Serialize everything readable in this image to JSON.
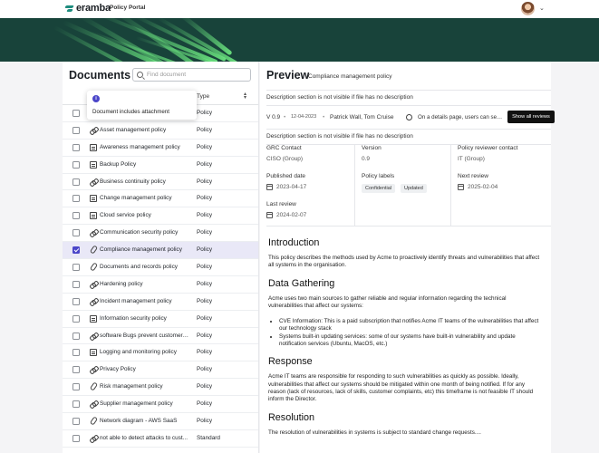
{
  "header": {
    "brand": "eramba",
    "portal": "Policy Portal"
  },
  "documents": {
    "title": "Documents",
    "search_placeholder": "Find document",
    "type_header": "Type",
    "tooltip": "Document includes attachment",
    "rows": [
      {
        "name": "",
        "type": "Policy",
        "icon": "none"
      },
      {
        "name": "Asset management policy",
        "type": "Policy",
        "icon": "link-icon"
      },
      {
        "name": "Awareness management policy",
        "type": "Policy",
        "icon": "document-icon"
      },
      {
        "name": "Backup Policy",
        "type": "Policy",
        "icon": "document-icon"
      },
      {
        "name": "Business continuity policy",
        "type": "Policy",
        "icon": "link-icon"
      },
      {
        "name": "Change management policy",
        "type": "Policy",
        "icon": "document-icon"
      },
      {
        "name": "Cloud service policy",
        "type": "Policy",
        "icon": "document-icon"
      },
      {
        "name": "Communication security policy",
        "type": "Policy",
        "icon": "link-icon"
      },
      {
        "name": "Compliance management policy",
        "type": "Policy",
        "icon": "paperclip-icon",
        "selected": true
      },
      {
        "name": "Documents and records policy",
        "type": "Policy",
        "icon": "paperclip-icon"
      },
      {
        "name": "Hardening policy",
        "type": "Policy",
        "icon": "link-icon"
      },
      {
        "name": "Incident management policy",
        "type": "Policy",
        "icon": "link-icon"
      },
      {
        "name": "Information security policy",
        "type": "Policy",
        "icon": "document-icon"
      },
      {
        "name": "software Bugs prevent customers...",
        "type": "Policy",
        "icon": "link-icon"
      },
      {
        "name": "Logging and monitoring policy",
        "type": "Policy",
        "icon": "document-icon"
      },
      {
        "name": "Privacy Policy",
        "type": "Policy",
        "icon": "link-icon"
      },
      {
        "name": "Risk management policy",
        "type": "Policy",
        "icon": "paperclip-icon"
      },
      {
        "name": "Supplier management policy",
        "type": "Policy",
        "icon": "link-icon"
      },
      {
        "name": "Network diagram - AWS SaaS",
        "type": "Policy",
        "icon": "paperclip-icon"
      },
      {
        "name": "not able to detect attacks to cust...",
        "type": "Standard",
        "icon": "link-icon"
      }
    ]
  },
  "preview": {
    "title": "Preview",
    "document_name": "Compliance management policy",
    "note": "Description section is not visible if file has no description",
    "version": "V 0.9",
    "date": "12-04-2023",
    "authors": "Patrick Wall, Tom Cruise",
    "comment": "On a details page, users can see...",
    "show_reviews": "Show all reviews",
    "meta": {
      "grc_contact_label": "GRC Contact",
      "grc_contact": "CISO (Group)",
      "version_label": "Version",
      "version": "0.9",
      "reviewer_label": "Policy reviewer contact",
      "reviewer": "IT (Group)",
      "published_label": "Published date",
      "published": "2023-04-17",
      "labels_label": "Policy labels",
      "label_1": "Confidential",
      "label_2": "Updated",
      "next_review_label": "Next review",
      "next_review": "2025-02-04",
      "last_review_label": "Last review",
      "last_review": "2024-02-07"
    },
    "content": {
      "h_intro": "Introduction",
      "p_intro": "This policy describes the methods used by Acme to proactively identify threats and vulnerabilities that affect all systems in the organisation.",
      "h_data": "Data Gathering",
      "p_data": "Acme uses two main sources to gather reliable and regular information regarding the technical vulnerabilities that affect our systems:",
      "li_1": "CVE Information: This is a paid subscription that notifies Acme IT teams of the vulnerabilities that affect our technology stack",
      "li_2": "Systems built-in updating services: some of our systems have built-in vulnerability and update notification services (Ubuntu, MacOS, etc.)",
      "h_resp": "Response",
      "p_resp": "Acme IT teams are responsible for responding to such vulnerabilities as quickly as possible.  Ideally, vulnerabilities that affect our systems should be mitigated within one month of being notified. If for any reason (lack of resources, lack of skills, customer complaints, etc) this timeframe is not feasible IT should inform the Director.",
      "h_resol": "Resolution",
      "p_resol": "The resolution of vulnerabilities in systems is subject to standard change requests...."
    }
  },
  "colors": {
    "accent": "#4b46c9",
    "banner": "#18433a",
    "brand": "#1e8c7e"
  }
}
